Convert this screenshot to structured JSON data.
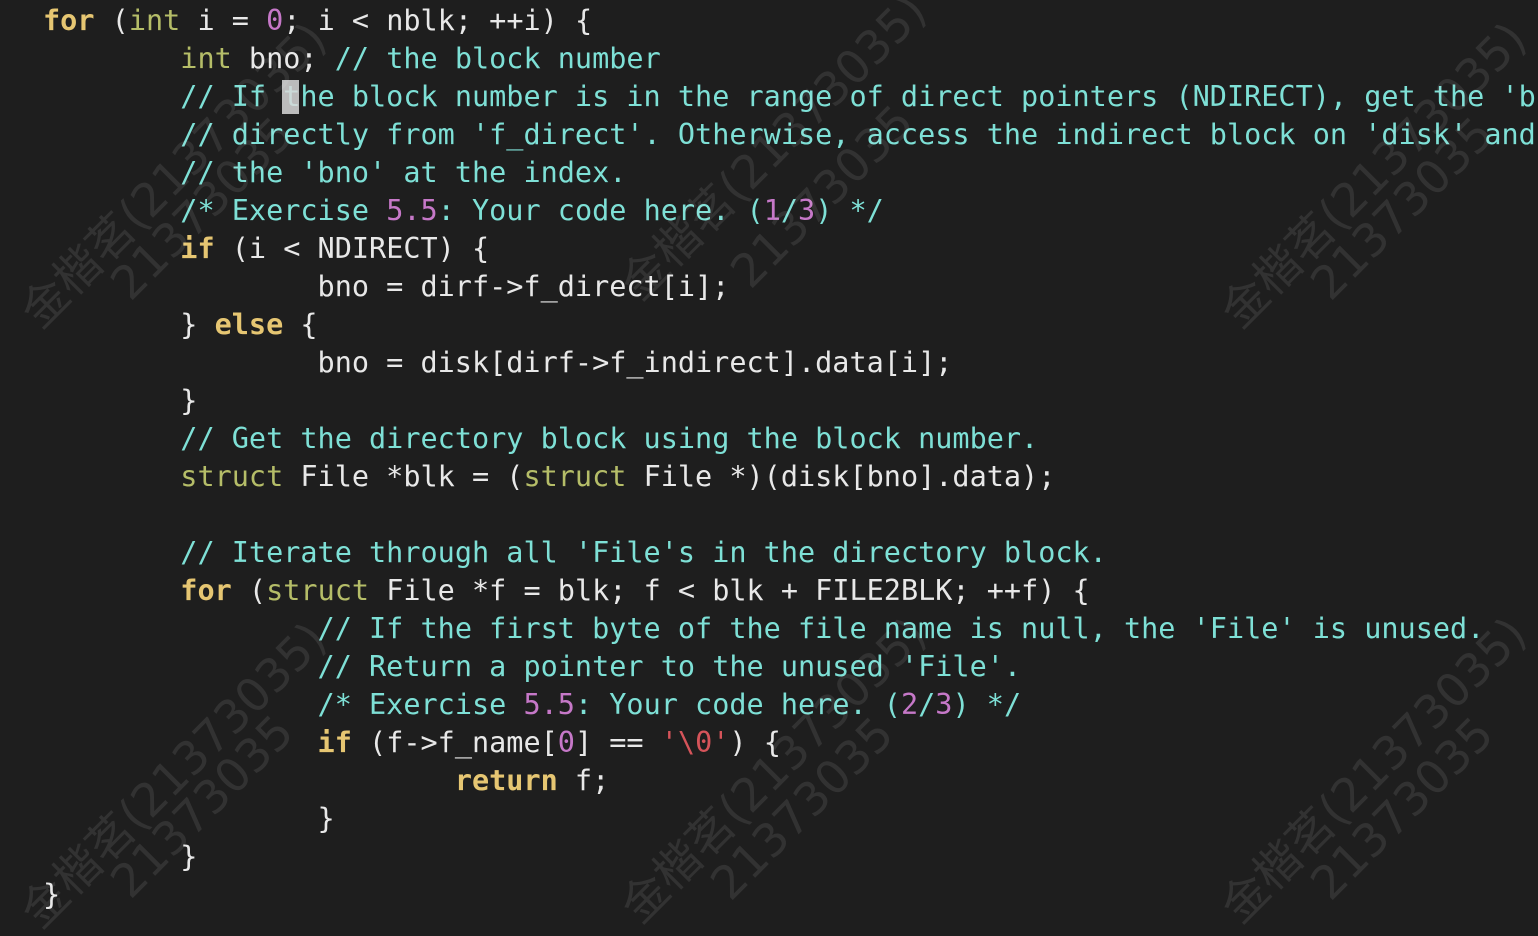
{
  "editor": {
    "colors": {
      "background": "#1e1e1e",
      "keyword": "#e6c672",
      "type": "#b5bd68",
      "number": "#c678c8",
      "comment": "#7ee0d6",
      "string": "#d6545a",
      "plain": "#e8e8e8"
    },
    "lines": [
      [
        {
          "t": "keyword",
          "v": "for"
        },
        {
          "t": "plain",
          "v": " ("
        },
        {
          "t": "type",
          "v": "int"
        },
        {
          "t": "plain",
          "v": " i = "
        },
        {
          "t": "number",
          "v": "0"
        },
        {
          "t": "plain",
          "v": "; i < nblk; ++i) {"
        }
      ],
      [
        {
          "t": "plain",
          "v": "        "
        },
        {
          "t": "type",
          "v": "int"
        },
        {
          "t": "plain",
          "v": " bno; "
        },
        {
          "t": "comment",
          "v": "// the block number"
        }
      ],
      [
        {
          "t": "plain",
          "v": "        "
        },
        {
          "t": "comment",
          "v": "// If the block number is in the range of direct pointers (NDIRECT), get the 'bno'"
        }
      ],
      [
        {
          "t": "plain",
          "v": "        "
        },
        {
          "t": "comment",
          "v": "// directly from 'f_direct'. Otherwise, access the indirect block on 'disk' and get"
        }
      ],
      [
        {
          "t": "plain",
          "v": "        "
        },
        {
          "t": "comment",
          "v": "// the 'bno' at the index."
        }
      ],
      [
        {
          "t": "plain",
          "v": "        "
        },
        {
          "t": "comment",
          "v": "/* Exercise "
        },
        {
          "t": "number",
          "v": "5.5"
        },
        {
          "t": "comment",
          "v": ": Your code here. ("
        },
        {
          "t": "number",
          "v": "1"
        },
        {
          "t": "comment",
          "v": "/"
        },
        {
          "t": "number",
          "v": "3"
        },
        {
          "t": "comment",
          "v": ") */"
        }
      ],
      [
        {
          "t": "plain",
          "v": "        "
        },
        {
          "t": "keyword",
          "v": "if"
        },
        {
          "t": "plain",
          "v": " (i < NDIRECT) {"
        }
      ],
      [
        {
          "t": "plain",
          "v": "                bno = dirf->f_direct[i];"
        }
      ],
      [
        {
          "t": "plain",
          "v": "        } "
        },
        {
          "t": "keyword",
          "v": "else"
        },
        {
          "t": "plain",
          "v": " {"
        }
      ],
      [
        {
          "t": "plain",
          "v": "                bno = disk[dirf->f_indirect].data[i];"
        }
      ],
      [
        {
          "t": "plain",
          "v": "        }"
        }
      ],
      [
        {
          "t": "plain",
          "v": "        "
        },
        {
          "t": "comment",
          "v": "// Get the directory block using the block number."
        }
      ],
      [
        {
          "t": "plain",
          "v": "        "
        },
        {
          "t": "type",
          "v": "struct"
        },
        {
          "t": "plain",
          "v": " File *blk = ("
        },
        {
          "t": "type",
          "v": "struct"
        },
        {
          "t": "plain",
          "v": " File *)(disk[bno].data);"
        }
      ],
      [],
      [
        {
          "t": "plain",
          "v": "        "
        },
        {
          "t": "comment",
          "v": "// Iterate through all 'File's in the directory block."
        }
      ],
      [
        {
          "t": "plain",
          "v": "        "
        },
        {
          "t": "keyword",
          "v": "for"
        },
        {
          "t": "plain",
          "v": " ("
        },
        {
          "t": "type",
          "v": "struct"
        },
        {
          "t": "plain",
          "v": " File *f = blk; f < blk + FILE2BLK; ++f) {"
        }
      ],
      [
        {
          "t": "plain",
          "v": "                "
        },
        {
          "t": "comment",
          "v": "// If the first byte of the file name is null, the 'File' is unused."
        }
      ],
      [
        {
          "t": "plain",
          "v": "                "
        },
        {
          "t": "comment",
          "v": "// Return a pointer to the unused 'File'."
        }
      ],
      [
        {
          "t": "plain",
          "v": "                "
        },
        {
          "t": "comment",
          "v": "/* Exercise "
        },
        {
          "t": "number",
          "v": "5.5"
        },
        {
          "t": "comment",
          "v": ": Your code here. ("
        },
        {
          "t": "number",
          "v": "2"
        },
        {
          "t": "comment",
          "v": "/"
        },
        {
          "t": "number",
          "v": "3"
        },
        {
          "t": "comment",
          "v": ") */"
        }
      ],
      [
        {
          "t": "plain",
          "v": "                "
        },
        {
          "t": "keyword",
          "v": "if"
        },
        {
          "t": "plain",
          "v": " (f->f_name["
        },
        {
          "t": "number",
          "v": "0"
        },
        {
          "t": "plain",
          "v": "] == "
        },
        {
          "t": "string",
          "v": "'\\0'"
        },
        {
          "t": "plain",
          "v": ") {"
        }
      ],
      [
        {
          "t": "plain",
          "v": "                        "
        },
        {
          "t": "keyword",
          "v": "return"
        },
        {
          "t": "plain",
          "v": " f;"
        }
      ],
      [
        {
          "t": "plain",
          "v": "                }"
        }
      ],
      [
        {
          "t": "plain",
          "v": "        }"
        }
      ],
      [
        {
          "t": "plain",
          "v": "}"
        }
      ]
    ]
  },
  "watermarks": {
    "name_text": "金楷茗(21373035)",
    "id_text": "21373035"
  }
}
